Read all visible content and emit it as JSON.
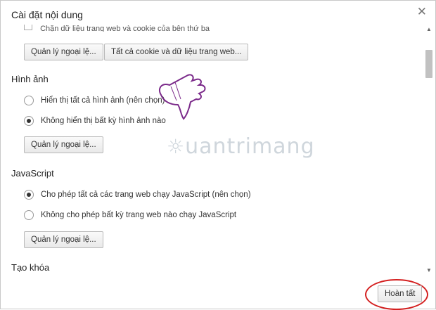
{
  "dialog": {
    "title": "Cài đặt nội dung",
    "close_icon": "close-icon"
  },
  "cookies": {
    "cut_off_text": "Chặn dữ liệu trang web và cookie của bên thứ ba",
    "manage_exceptions": "Quản lý ngoại lệ...",
    "all_cookies": "Tất cả cookie và dữ liệu trang web..."
  },
  "images": {
    "heading": "Hình ảnh",
    "options": [
      {
        "label": "Hiển thị tất cả hình ảnh (nên chọn)",
        "checked": false
      },
      {
        "label": "Không hiển thị bất kỳ hình ảnh nào",
        "checked": true
      }
    ],
    "manage_exceptions": "Quản lý ngoại lệ..."
  },
  "javascript": {
    "heading": "JavaScript",
    "options": [
      {
        "label": "Cho phép tất cả các trang web chạy JavaScript (nên chọn)",
        "checked": true
      },
      {
        "label": "Không cho phép bất kỳ trang web nào chạy JavaScript",
        "checked": false
      }
    ],
    "manage_exceptions": "Quản lý ngoại lệ..."
  },
  "keygen": {
    "heading": "Tạo khóa"
  },
  "footer": {
    "done": "Hoàn tất"
  },
  "watermark": {
    "text": "uantrimang"
  },
  "colors": {
    "highlight_ring": "#d42020",
    "watermark_hand": "#7b2a8a"
  }
}
